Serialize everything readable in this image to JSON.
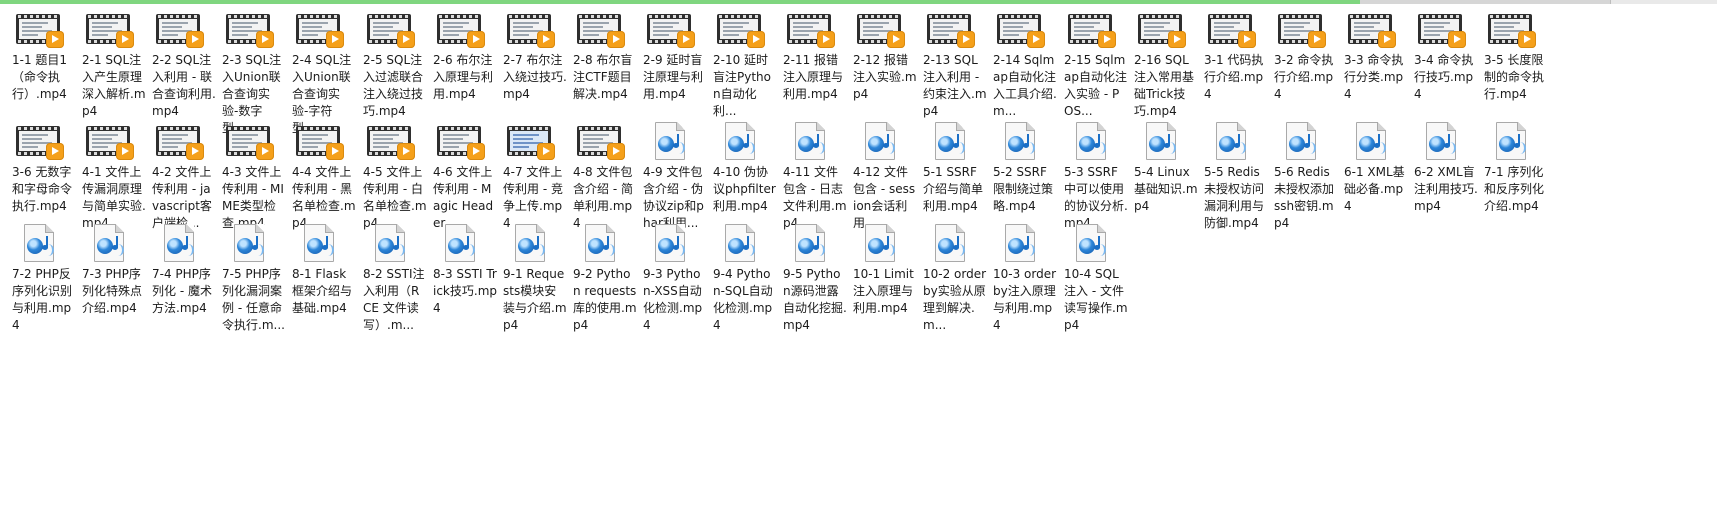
{
  "items": [
    {
      "name": "1-1 题目1（命令执行）.mp4",
      "icon": "video-thumbnail-icon"
    },
    {
      "name": "2-1 SQL注入产生原理深入解析.mp4",
      "icon": "video-thumbnail-icon"
    },
    {
      "name": "2-2 SQL注入利用 - 联合查询利用.mp4",
      "icon": "video-thumbnail-icon"
    },
    {
      "name": "2-3 SQL注入Union联合查询实验-数字型....",
      "icon": "video-thumbnail-icon"
    },
    {
      "name": "2-4 SQL注入Union联合查询实验-字符型....",
      "icon": "video-thumbnail-icon"
    },
    {
      "name": "2-5 SQL注入过滤联合注入绕过技巧.mp4",
      "icon": "video-thumbnail-icon"
    },
    {
      "name": "2-6 布尔注入原理与利用.mp4",
      "icon": "video-thumbnail-icon"
    },
    {
      "name": "2-7 布尔注入绕过技巧.mp4",
      "icon": "video-thumbnail-icon"
    },
    {
      "name": "2-8 布尔盲注CTF题目解决.mp4",
      "icon": "video-thumbnail-icon"
    },
    {
      "name": "2-9 延时盲注原理与利用.mp4",
      "icon": "video-thumbnail-icon"
    },
    {
      "name": "2-10 延时盲注Python自动化利...",
      "icon": "video-thumbnail-icon"
    },
    {
      "name": "2-11 报错注入原理与利用.mp4",
      "icon": "video-thumbnail-icon"
    },
    {
      "name": "2-12 报错注入实验.mp4",
      "icon": "video-thumbnail-icon"
    },
    {
      "name": "2-13 SQL注入利用 - 约束注入.mp4",
      "icon": "video-thumbnail-icon"
    },
    {
      "name": "2-14 Sqlmap自动化注入工具介绍.m...",
      "icon": "video-thumbnail-icon"
    },
    {
      "name": "2-15 Sqlmap自动化注入实验 - POS...",
      "icon": "video-thumbnail-icon"
    },
    {
      "name": "2-16 SQL注入常用基础Trick技巧.mp4",
      "icon": "video-thumbnail-icon"
    },
    {
      "name": "3-1 代码执行介绍.mp4",
      "icon": "video-thumbnail-icon"
    },
    {
      "name": "3-2 命令执行介绍.mp4",
      "icon": "video-thumbnail-icon"
    },
    {
      "name": "3-3 命令执行分类.mp4",
      "icon": "video-thumbnail-icon"
    },
    {
      "name": "3-4 命令执行技巧.mp4",
      "icon": "video-thumbnail-icon"
    },
    {
      "name": "3-5 长度限制的命令执行.mp4",
      "icon": "video-thumbnail-icon"
    },
    {
      "name": "3-6 无数字和字母命令执行.mp4",
      "icon": "video-thumbnail-icon"
    },
    {
      "name": "4-1 文件上传漏洞原理与简单实验.mp4",
      "icon": "video-thumbnail-icon"
    },
    {
      "name": "4-2 文件上传利用 - javascript客户端检...",
      "icon": "video-thumbnail-icon"
    },
    {
      "name": "4-3 文件上传利用 - MIME类型检查.mp4",
      "icon": "video-thumbnail-icon"
    },
    {
      "name": "4-4 文件上传利用 - 黑名单检查.mp4",
      "icon": "video-thumbnail-icon"
    },
    {
      "name": "4-5 文件上传利用 - 白名单检查.mp4",
      "icon": "video-thumbnail-icon"
    },
    {
      "name": "4-6 文件上传利用 - Magic Header...",
      "icon": "video-thumbnail-icon"
    },
    {
      "name": "4-7 文件上传利用 - 竞争上传.mp4",
      "icon": "video-thumbnail-icon"
    },
    {
      "name": "4-8 文件包含介绍 - 简单利用.mp4",
      "icon": "video-thumbnail-icon"
    },
    {
      "name": "4-9 文件包含介绍 - 伪协议zip和phar利用...",
      "icon": "media-file-icon"
    },
    {
      "name": "4-10 伪协议phpfilter利用.mp4",
      "icon": "media-file-icon"
    },
    {
      "name": "4-11 文件包含 - 日志文件利用.mp4",
      "icon": "media-file-icon"
    },
    {
      "name": "4-12 文件包含 - session会话利用....",
      "icon": "media-file-icon"
    },
    {
      "name": "5-1 SSRF介绍与简单利用.mp4",
      "icon": "media-file-icon"
    },
    {
      "name": "5-2 SSRF限制绕过策略.mp4",
      "icon": "media-file-icon"
    },
    {
      "name": "5-3 SSRF中可以使用的协议分析.mp4",
      "icon": "media-file-icon"
    },
    {
      "name": "5-4 Linux基础知识.mp4",
      "icon": "media-file-icon"
    },
    {
      "name": "5-5 Redis未授权访问漏洞利用与防御.mp4",
      "icon": "media-file-icon"
    },
    {
      "name": "5-6 Redis未授权添加ssh密钥.mp4",
      "icon": "media-file-icon"
    },
    {
      "name": "6-1 XML基础必备.mp4",
      "icon": "media-file-icon"
    },
    {
      "name": "6-2 XML盲注利用技巧.mp4",
      "icon": "media-file-icon"
    },
    {
      "name": "7-1 序列化和反序列化介绍.mp4",
      "icon": "media-file-icon"
    },
    {
      "name": "7-2 PHP反序列化识别与利用.mp4",
      "icon": "media-file-icon"
    },
    {
      "name": "7-3 PHP序列化特殊点介绍.mp4",
      "icon": "media-file-icon"
    },
    {
      "name": "7-4 PHP序列化 - 魔术方法.mp4",
      "icon": "media-file-icon"
    },
    {
      "name": "7-5 PHP序列化漏洞案例 - 任意命令执行.m...",
      "icon": "media-file-icon"
    },
    {
      "name": "8-1 Flask框架介绍与基础.mp4",
      "icon": "media-file-icon"
    },
    {
      "name": "8-2 SSTI注入利用（RCE 文件读写）.m...",
      "icon": "media-file-icon"
    },
    {
      "name": "8-3 SSTI Trick技巧.mp4",
      "icon": "media-file-icon"
    },
    {
      "name": "9-1 Requests模块安装与介绍.mp4",
      "icon": "media-file-icon"
    },
    {
      "name": "9-2 Python requests库的使用.mp4",
      "icon": "media-file-icon"
    },
    {
      "name": "9-3 Python-XSS自动化检测.mp4",
      "icon": "media-file-icon"
    },
    {
      "name": "9-4 Python-SQL自动化检测.mp4",
      "icon": "media-file-icon"
    },
    {
      "name": "9-5 Python源码泄露自动化挖掘.mp4",
      "icon": "media-file-icon"
    },
    {
      "name": "10-1 Limit注入原理与利用.mp4",
      "icon": "media-file-icon"
    },
    {
      "name": "10-2 order by实验从原理到解决.m...",
      "icon": "media-file-icon"
    },
    {
      "name": "10-3 order by注入原理与利用.mp4",
      "icon": "media-file-icon"
    },
    {
      "name": "10-4 SQL注入 - 文件读写操作.mp4",
      "icon": "media-file-icon"
    }
  ]
}
